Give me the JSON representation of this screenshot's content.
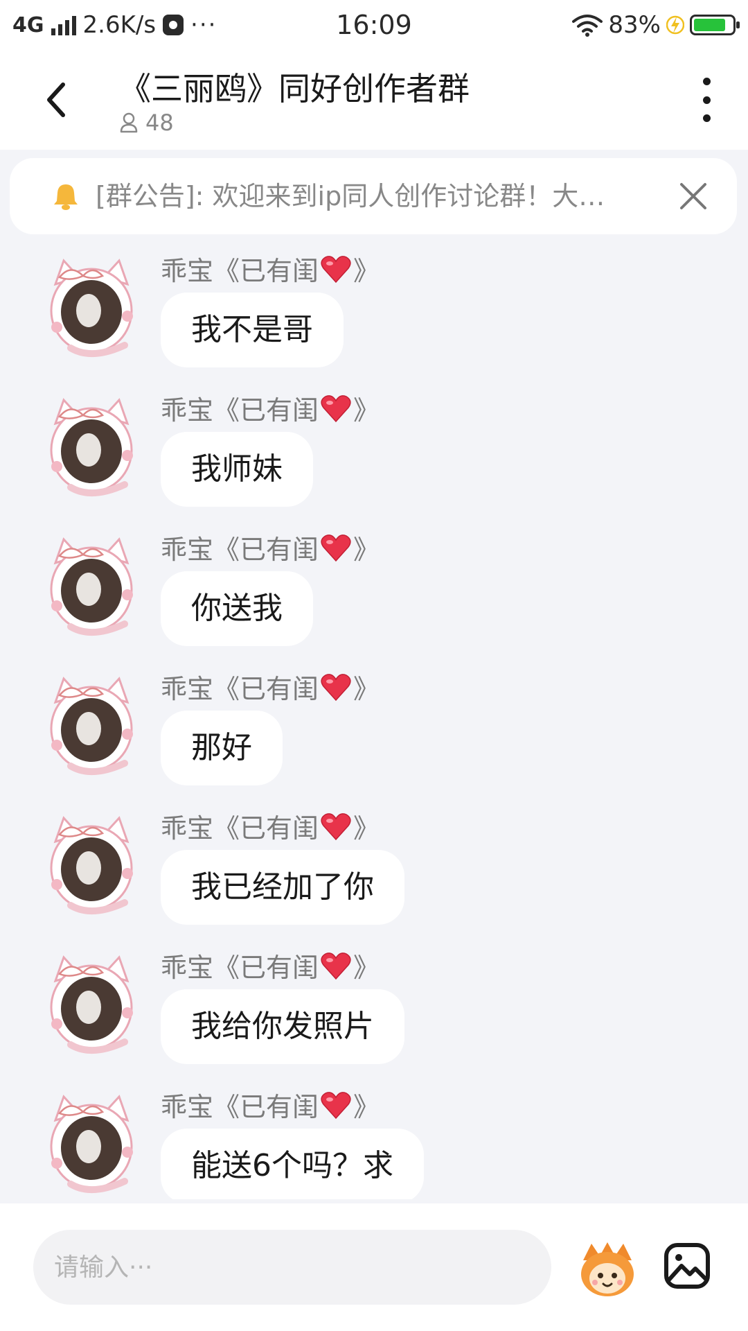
{
  "status_bar": {
    "network": "4G",
    "speed": "2.6K/s",
    "more": "···",
    "time": "16:09",
    "battery_percent": "83%",
    "battery_level": 0.83
  },
  "header": {
    "title": "《三丽鸥》同好创作者群",
    "member_count": "48"
  },
  "announcement": {
    "text": "[群公告]: 欢迎来到ip同人创作讨论群！大…"
  },
  "messages": [
    {
      "sender_prefix": "乖宝《已有闺",
      "sender_suffix": "》",
      "text": "我不是哥"
    },
    {
      "sender_prefix": "乖宝《已有闺",
      "sender_suffix": "》",
      "text": "我师妹"
    },
    {
      "sender_prefix": "乖宝《已有闺",
      "sender_suffix": "》",
      "text": "你送我"
    },
    {
      "sender_prefix": "乖宝《已有闺",
      "sender_suffix": "》",
      "text": "那好"
    },
    {
      "sender_prefix": "乖宝《已有闺",
      "sender_suffix": "》",
      "text": "我已经加了你"
    },
    {
      "sender_prefix": "乖宝《已有闺",
      "sender_suffix": "》",
      "text": "我给你发照片"
    },
    {
      "sender_prefix": "乖宝《已有闺",
      "sender_suffix": "》",
      "text": "能送6个吗？求"
    }
  ],
  "input": {
    "placeholder": "请输入···"
  },
  "icons": {
    "back": "chevron-left-icon",
    "menu": "more-vertical-icon",
    "bell": "bell-icon",
    "close": "close-icon",
    "heart": "heart-icon",
    "emoji": "emoji-mascot-icon",
    "image": "image-icon"
  },
  "colors": {
    "background": "#f3f4f8",
    "bubble": "#ffffff",
    "bell": "#f5b73b",
    "heart": "#e8334a",
    "battery": "#27c23a"
  }
}
